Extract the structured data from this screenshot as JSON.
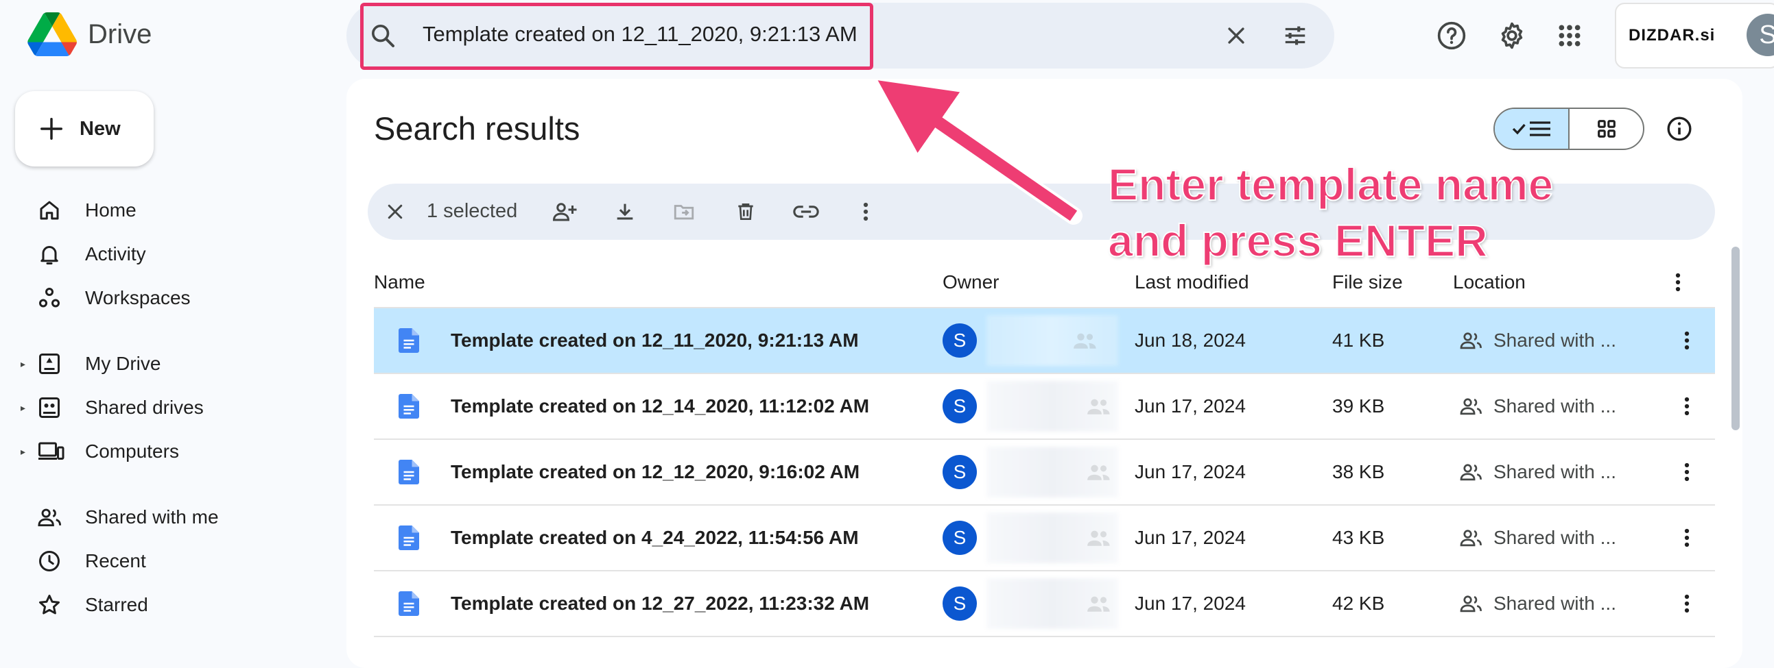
{
  "app": {
    "name": "Drive"
  },
  "search": {
    "value": "Template created on 12_11_2020, 9:21:13 AM"
  },
  "header": {
    "brand": "DIZDAR.si",
    "avatar_letter": "S"
  },
  "sidebar": {
    "new_label": "New",
    "items": [
      {
        "label": "Home",
        "icon": "home-icon"
      },
      {
        "label": "Activity",
        "icon": "bell-icon"
      },
      {
        "label": "Workspaces",
        "icon": "workspaces-icon"
      },
      {
        "label": "My Drive",
        "icon": "my-drive-icon"
      },
      {
        "label": "Shared drives",
        "icon": "shared-drives-icon"
      },
      {
        "label": "Computers",
        "icon": "computers-icon"
      },
      {
        "label": "Shared with me",
        "icon": "people-icon"
      },
      {
        "label": "Recent",
        "icon": "clock-icon"
      },
      {
        "label": "Starred",
        "icon": "star-icon"
      }
    ]
  },
  "main": {
    "title": "Search results",
    "selection": {
      "text": "1 selected"
    },
    "columns": {
      "name": "Name",
      "owner": "Owner",
      "modified": "Last modified",
      "size": "File size",
      "location": "Location"
    },
    "rows": [
      {
        "name": "Template created on 12_11_2020, 9:21:13 AM",
        "owner_letter": "S",
        "modified": "Jun 18, 2024",
        "size": "41 KB",
        "location": "Shared with ...",
        "selected": true
      },
      {
        "name": "Template created on 12_14_2020, 11:12:02 AM",
        "owner_letter": "S",
        "modified": "Jun 17, 2024",
        "size": "39 KB",
        "location": "Shared with ...",
        "selected": false
      },
      {
        "name": "Template created on 12_12_2020, 9:16:02 AM",
        "owner_letter": "S",
        "modified": "Jun 17, 2024",
        "size": "38 KB",
        "location": "Shared with ...",
        "selected": false
      },
      {
        "name": "Template created on 4_24_2022, 11:54:56 AM",
        "owner_letter": "S",
        "modified": "Jun 17, 2024",
        "size": "43 KB",
        "location": "Shared with ...",
        "selected": false
      },
      {
        "name": "Template created on 12_27_2022, 11:23:32 AM",
        "owner_letter": "S",
        "modified": "Jun 17, 2024",
        "size": "42 KB",
        "location": "Shared with ...",
        "selected": false
      }
    ]
  },
  "annotation": {
    "line1": "Enter template name",
    "line2": "and press ENTER",
    "color": "#ee3d73"
  },
  "colors": {
    "selected_row": "#c2e7ff",
    "accent": "#0b57d0",
    "highlight": "#e8336b"
  }
}
